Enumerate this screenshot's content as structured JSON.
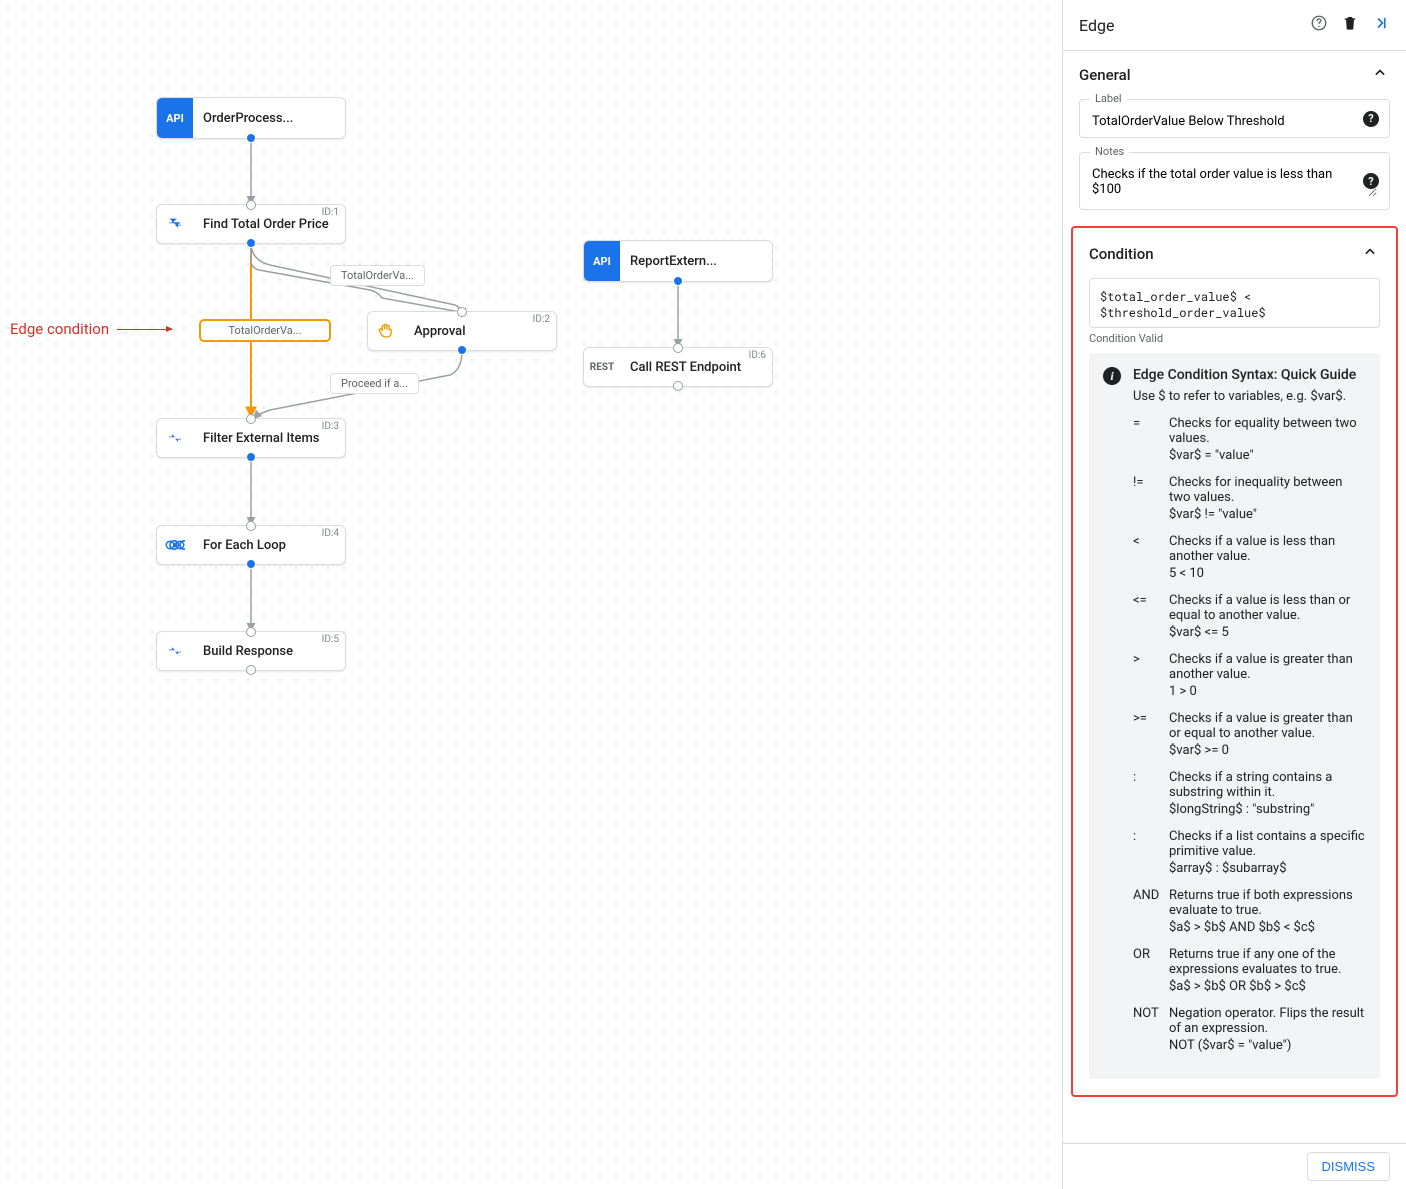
{
  "annotation": "Edge condition",
  "canvas": {
    "nodes": {
      "trigger1": {
        "label": "OrderProcess...",
        "icon_text": "API"
      },
      "n1": {
        "id": "ID:1",
        "label": "Find Total Order Price"
      },
      "n2": {
        "id": "ID:2",
        "label": "Approval"
      },
      "n3": {
        "id": "ID:3",
        "label": "Filter External Items"
      },
      "n4": {
        "id": "ID:4",
        "label": "For Each Loop"
      },
      "n5": {
        "id": "ID:5",
        "label": "Build Response"
      },
      "trigger2": {
        "label": "ReportExtern...",
        "icon_text": "API"
      },
      "n6": {
        "id": "ID:6",
        "label": "Call REST Endpoint",
        "icon_text": "REST"
      }
    },
    "edge_labels": {
      "e1": "TotalOrderVa...",
      "e2": "TotalOrderVa...",
      "e3": "Proceed if a..."
    }
  },
  "sidebar": {
    "title": "Edge",
    "sections": {
      "general": {
        "title": "General",
        "label_legend": "Label",
        "label_value": "TotalOrderValue Below Threshold",
        "notes_legend": "Notes",
        "notes_value": "Checks if the total order value is less than $100"
      },
      "condition": {
        "title": "Condition",
        "expression": "$total_order_value$ < $threshold_order_value$",
        "status": "Condition Valid",
        "guide": {
          "heading": "Edge Condition Syntax: Quick Guide",
          "intro": "Use $ to refer to variables, e.g. $var$.",
          "rows": [
            {
              "op": "=",
              "desc": "Checks for equality between two values.",
              "ex": "$var$ = \"value\""
            },
            {
              "op": "!=",
              "desc": "Checks for inequality between two values.",
              "ex": "$var$ != \"value\""
            },
            {
              "op": "<",
              "desc": "Checks if a value is less than another value.",
              "ex": "5 < 10"
            },
            {
              "op": "<=",
              "desc": "Checks if a value is less than or equal to another value.",
              "ex": "$var$ <= 5"
            },
            {
              "op": ">",
              "desc": "Checks if a value is greater than another value.",
              "ex": "1 > 0"
            },
            {
              "op": ">=",
              "desc": "Checks if a value is greater than or equal to another value.",
              "ex": "$var$ >= 0"
            },
            {
              "op": ":",
              "desc": "Checks if a string contains a substring within it.",
              "ex": "$longString$ : \"substring\""
            },
            {
              "op": ":",
              "desc": "Checks if a list contains a specific primitive value.",
              "ex": "$array$ : $subarray$"
            },
            {
              "op": "AND",
              "desc": "Returns true if both expressions evaluate to true.",
              "ex": "$a$ > $b$ AND $b$ < $c$"
            },
            {
              "op": "OR",
              "desc": "Returns true if any one of the expressions evaluates to true.",
              "ex": "$a$ > $b$ OR $b$ > $c$"
            },
            {
              "op": "NOT",
              "desc": "Negation operator. Flips the result of an expression.",
              "ex": "NOT ($var$ = \"value\")"
            }
          ]
        }
      }
    },
    "dismiss": "DISMISS"
  }
}
